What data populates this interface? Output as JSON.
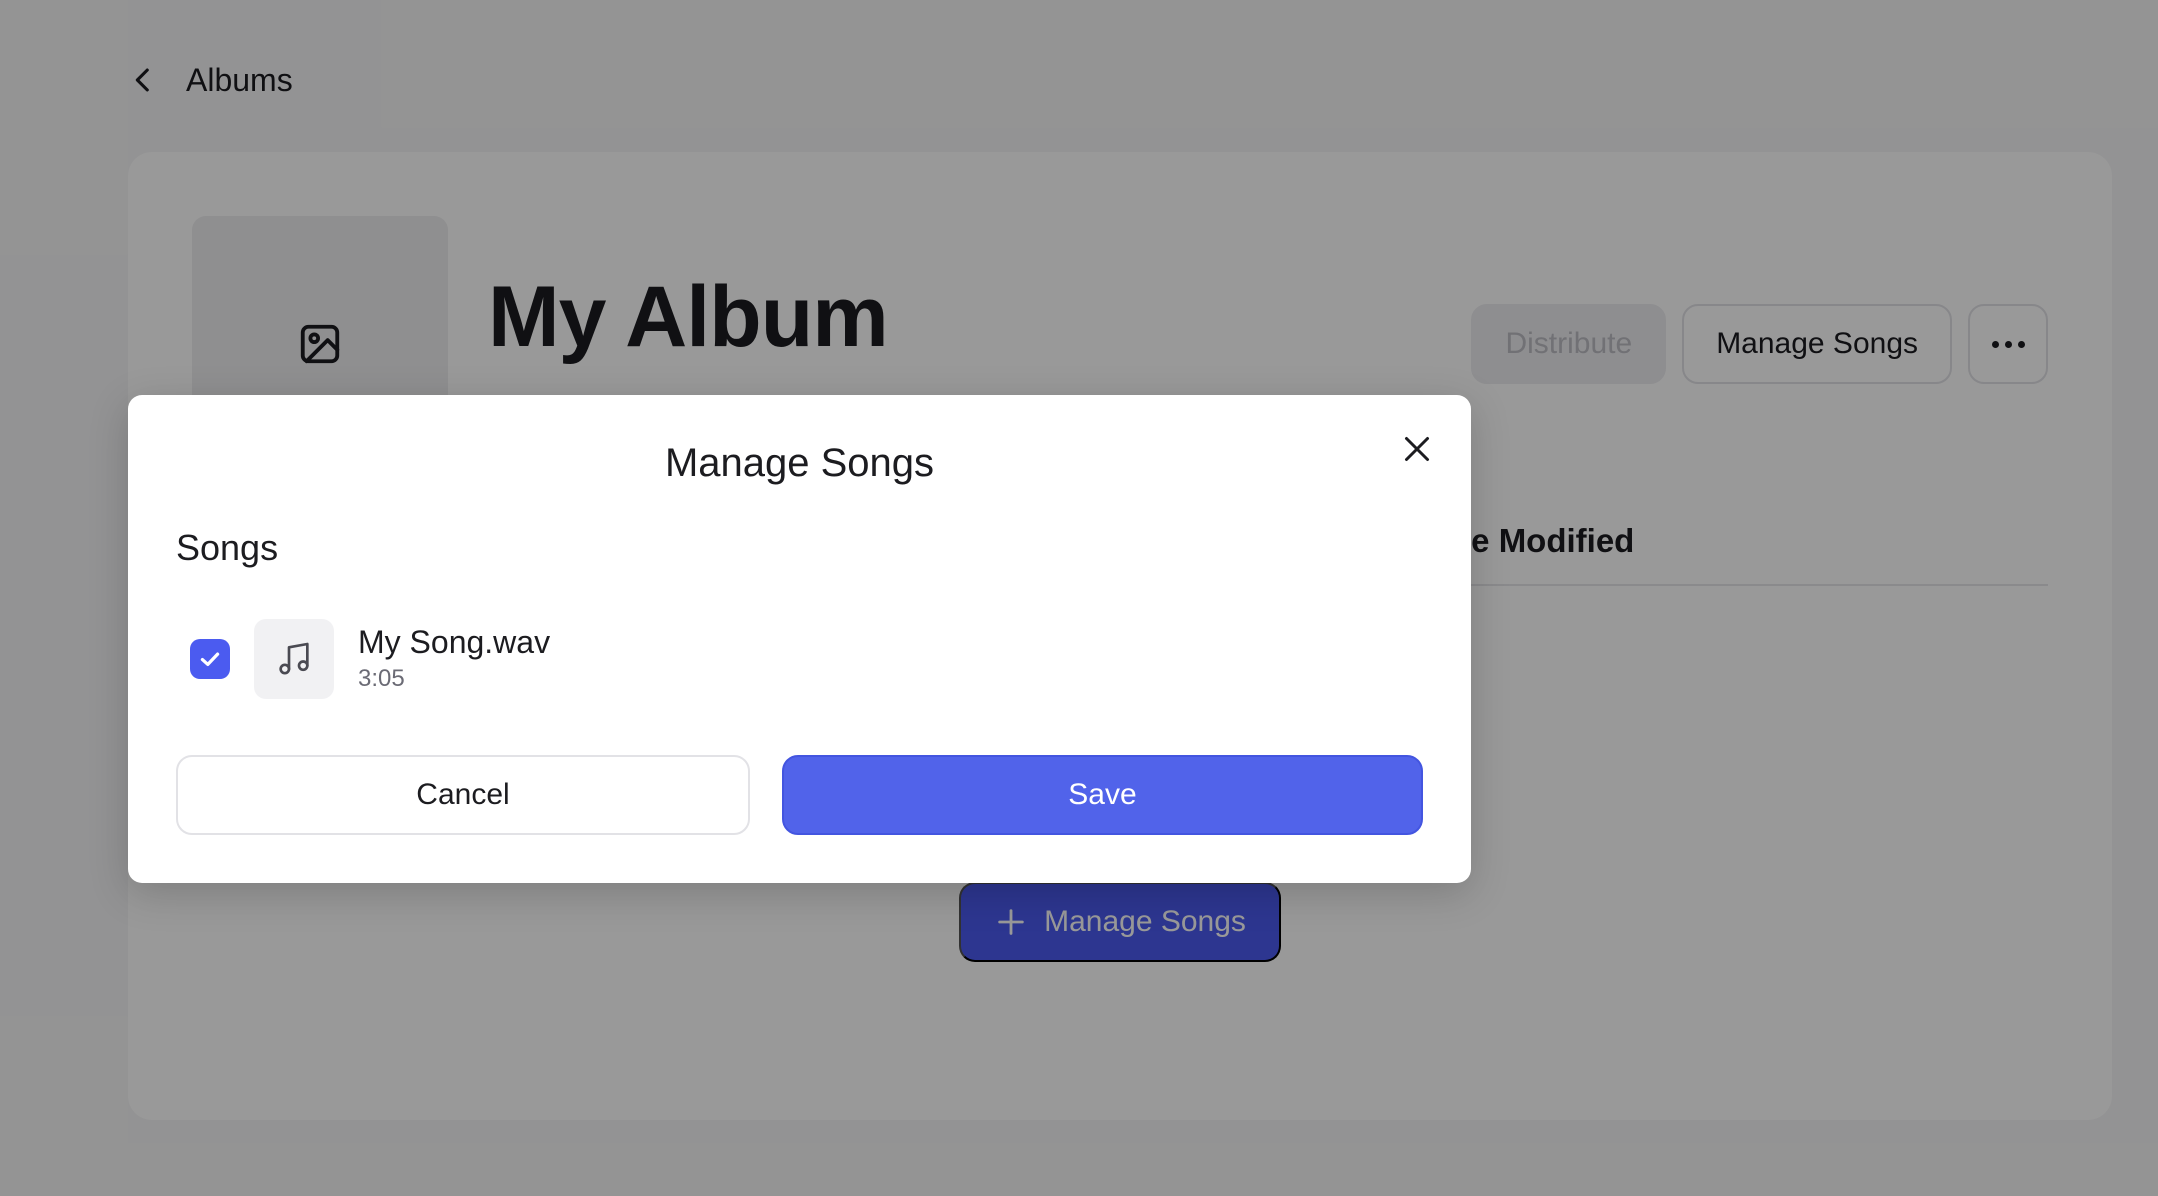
{
  "header": {
    "back_label": "Albums"
  },
  "album": {
    "title": "My Album",
    "actions": {
      "distribute_label": "Distribute",
      "manage_songs_label": "Manage Songs"
    },
    "table": {
      "column_date_modified": "Date Modified"
    },
    "empty_state": {
      "add_button_label": "Manage Songs"
    }
  },
  "modal": {
    "title": "Manage Songs",
    "section_label": "Songs",
    "songs": [
      {
        "name": "My Song.wav",
        "duration": "3:05",
        "checked": true
      }
    ],
    "cancel_label": "Cancel",
    "save_label": "Save"
  },
  "colors": {
    "accent": "#5163EA",
    "overlay": "rgba(0,0,0,0.40)"
  },
  "icons": {
    "back": "chevron-left-icon",
    "cover": "image-icon",
    "more": "more-horizontal-icon",
    "add": "plus-icon",
    "close": "close-icon",
    "check": "check-icon",
    "song": "music-note-icon"
  }
}
